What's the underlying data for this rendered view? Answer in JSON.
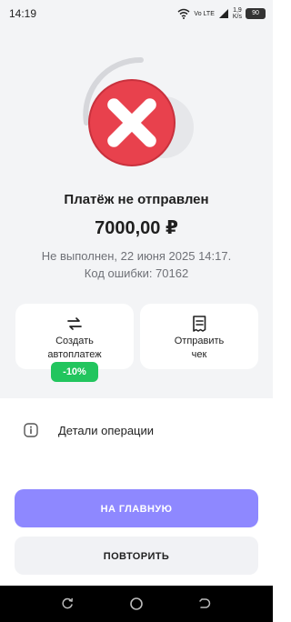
{
  "status_bar": {
    "time": "14:19",
    "network_label": "Vo LTE",
    "speed_value": "1,9",
    "speed_unit": "K/s",
    "battery": "90"
  },
  "payment": {
    "title": "Платёж не отправлен",
    "amount": "7000,00 ₽",
    "status_line": "Не выполнен, 22 июня 2025 14:17.",
    "error_line": "Код ошибки: 70162"
  },
  "actions": {
    "autopay_label_line1": "Создать",
    "autopay_label_line2": "автоплатеж",
    "autopay_badge": "-10%",
    "send_receipt_line1": "Отправить",
    "send_receipt_line2": "чек"
  },
  "details": {
    "label": "Детали операции"
  },
  "buttons": {
    "main": "НА ГЛАВНУЮ",
    "repeat": "ПОВТОРИТЬ"
  },
  "colors": {
    "accent": "#8e88ff",
    "error_red": "#e8414d",
    "badge_green": "#22c55e"
  }
}
